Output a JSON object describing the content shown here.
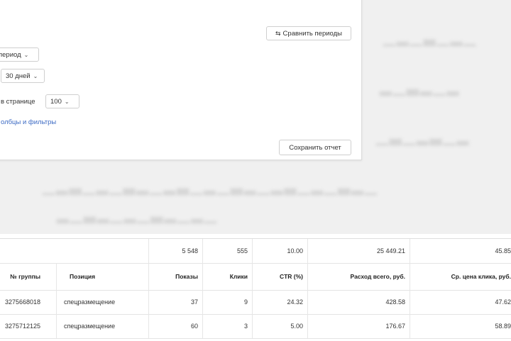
{
  "panel": {
    "compare_button": "Сравнить периоды",
    "period_select": "период",
    "days_select": "30 дней",
    "per_page_label": "в странице",
    "per_page_select": "100",
    "columns_link": "олбцы и фильтры",
    "save_button": "Сохранить отчет"
  },
  "table": {
    "totals": [
      "5 548",
      "555",
      "10.00",
      "25 449.21",
      "45.85"
    ],
    "headers": [
      "№ группы",
      "Позиция",
      "Показы",
      "Клики",
      "CTR (%)",
      "Расход всего, руб.",
      "Ср. цена клика, руб."
    ],
    "rows": [
      [
        "3275668018",
        "спецразмещение",
        "37",
        "9",
        "24.32",
        "428.58",
        "47.62"
      ],
      [
        "3275712125",
        "спецразмещение",
        "60",
        "3",
        "5.00",
        "176.67",
        "58.89"
      ]
    ]
  },
  "colors": {
    "link": "#3d6bc4",
    "backdrop": "#f0f0f0"
  }
}
